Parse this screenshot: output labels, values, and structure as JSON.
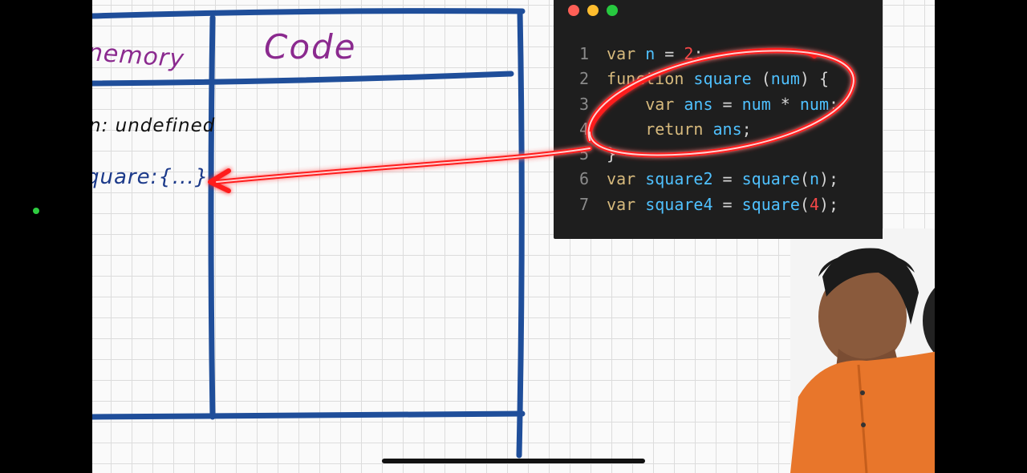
{
  "board": {
    "memory_header": "nemory",
    "code_header": "Code",
    "memory_entries": [
      {
        "text": "n: undefined"
      },
      {
        "text": "quare:{...}"
      }
    ]
  },
  "editor": {
    "lines": [
      {
        "num": "1",
        "tokens": [
          [
            "kw",
            "var"
          ],
          [
            "op",
            " "
          ],
          [
            "id",
            "n"
          ],
          [
            "op",
            " = "
          ],
          [
            "num",
            "2"
          ],
          [
            "pu",
            ";"
          ]
        ]
      },
      {
        "num": "2",
        "tokens": [
          [
            "kw",
            "function"
          ],
          [
            "op",
            " "
          ],
          [
            "fn",
            "square"
          ],
          [
            "op",
            " ("
          ],
          [
            "id",
            "num"
          ],
          [
            "op",
            ") {"
          ]
        ]
      },
      {
        "num": "3",
        "tokens": [
          [
            "op",
            "    "
          ],
          [
            "kw",
            "var"
          ],
          [
            "op",
            " "
          ],
          [
            "id",
            "ans"
          ],
          [
            "op",
            " = "
          ],
          [
            "id",
            "num"
          ],
          [
            "op",
            " * "
          ],
          [
            "id",
            "num"
          ],
          [
            "pu",
            ";"
          ]
        ]
      },
      {
        "num": "4",
        "tokens": [
          [
            "op",
            "    "
          ],
          [
            "kw",
            "return"
          ],
          [
            "op",
            " "
          ],
          [
            "id",
            "ans"
          ],
          [
            "pu",
            ";"
          ]
        ]
      },
      {
        "num": "5",
        "tokens": [
          [
            "op",
            "}"
          ]
        ]
      },
      {
        "num": "6",
        "tokens": [
          [
            "kw",
            "var"
          ],
          [
            "op",
            " "
          ],
          [
            "id",
            "square2"
          ],
          [
            "op",
            " = "
          ],
          [
            "fn",
            "square"
          ],
          [
            "op",
            "("
          ],
          [
            "id",
            "n"
          ],
          [
            "op",
            ");"
          ]
        ]
      },
      {
        "num": "7",
        "tokens": [
          [
            "kw",
            "var"
          ],
          [
            "op",
            " "
          ],
          [
            "id",
            "square4"
          ],
          [
            "op",
            " = "
          ],
          [
            "fn",
            "square"
          ],
          [
            "op",
            "("
          ],
          [
            "num",
            "4"
          ],
          [
            "op",
            ");"
          ]
        ]
      }
    ],
    "window_buttons": [
      "close",
      "minimize",
      "maximize"
    ]
  },
  "colors": {
    "board_line": "#1f4e9a",
    "header_ink": "#8b2a8f",
    "laser": "#ff1a1a",
    "editor_bg": "#1e1e1e"
  }
}
